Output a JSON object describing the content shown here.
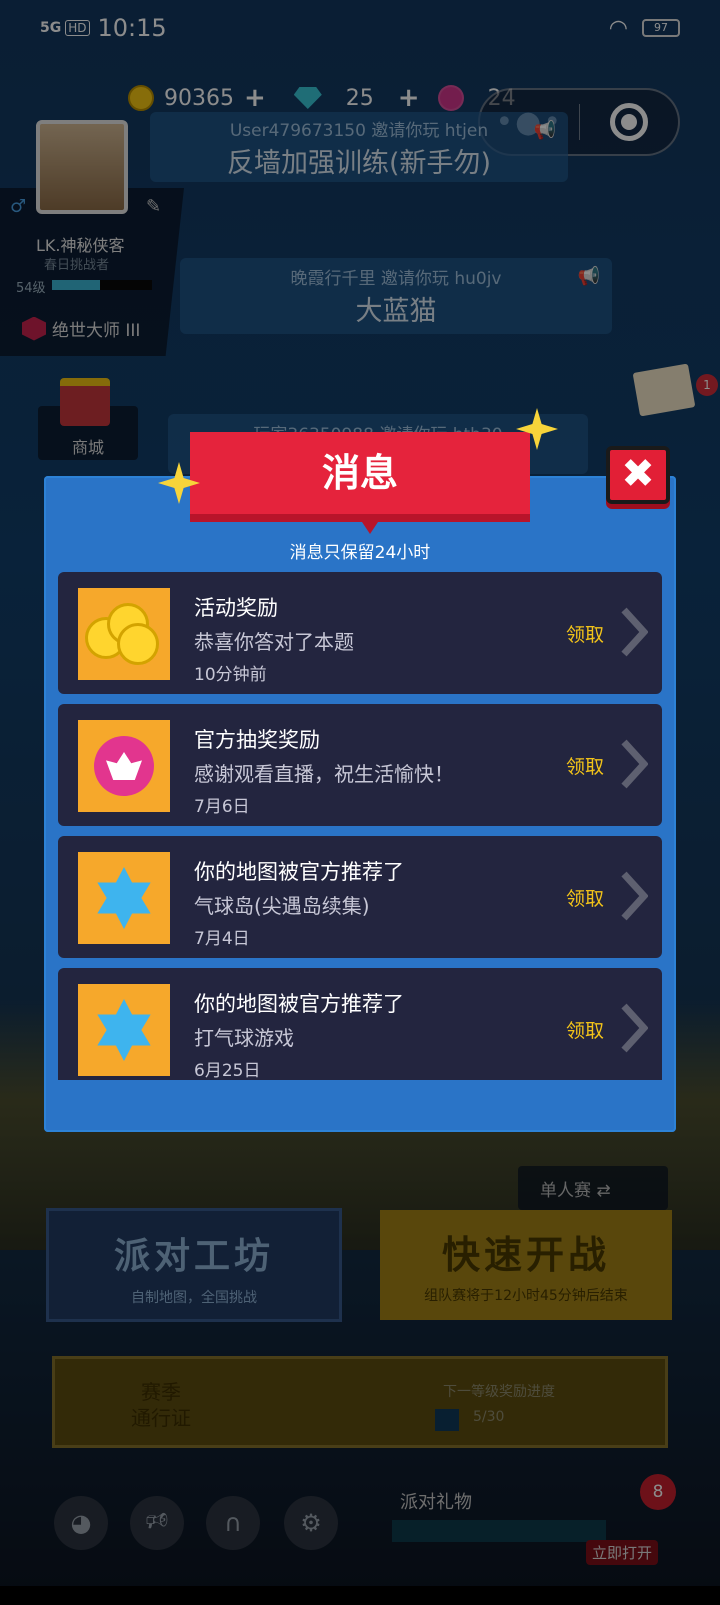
{
  "status_bar": {
    "signal": "5G",
    "hd": "HD",
    "time": "10:15",
    "battery": "97"
  },
  "currency": {
    "coins": "90365",
    "gems": "25",
    "tickets": "24"
  },
  "profile": {
    "name": "LK.神秘侠客",
    "subtitle": "春日挑战者",
    "level": "54级",
    "rank": "绝世大师 III",
    "level_progress": 0.48
  },
  "chat": [
    {
      "who": "User479673150 邀请你玩 htjen",
      "what": "反墙加强训练(新手勿)"
    },
    {
      "who": "晚霞行千里 邀请你玩 hu0jv",
      "what": "大蓝猫"
    },
    {
      "who": "玩家36350988 邀请你玩 htb30",
      "what": ""
    }
  ],
  "shop_label": "商城",
  "cards_badge": "1",
  "dialog": {
    "title": "消息",
    "note": "消息只保留24小时",
    "messages": [
      {
        "icon": "gold-coins-icon",
        "title": "活动奖励",
        "body": "恭喜你答对了本题",
        "time": "10分钟前",
        "action": "领取"
      },
      {
        "icon": "lotus-ticket-icon",
        "title": "官方抽奖奖励",
        "body": "感谢观看直播，祝生活愉快！",
        "time": "7月6日",
        "action": "领取"
      },
      {
        "icon": "blue-crystal-icon",
        "title": "你的地图被官方推荐了",
        "body": "气球岛(尖遇岛续集)",
        "time": "7月4日",
        "action": "领取"
      },
      {
        "icon": "blue-crystal-icon",
        "title": "你的地图被官方推荐了",
        "body": "打气球游戏",
        "time": "6月25日",
        "action": "领取"
      }
    ]
  },
  "bottom": {
    "solo_mode": "单人赛",
    "workshop_title": "派对工坊",
    "workshop_sub": "自制地图，全国挑战",
    "quick_title": "快速开战",
    "quick_sub": "组队赛将于12小时45分钟后结束",
    "pass_label_1": "赛季",
    "pass_label_2": "通行证",
    "pass_progress_label": "下一等级奖励进度",
    "pass_progress": "5/30",
    "gift_label": "派对礼物",
    "gift_open": "立即打开",
    "gift_badge": "8"
  },
  "colors": {
    "dialog_blue": "#2a74c7",
    "banner_red": "#e5233c",
    "card_bg": "#23253f",
    "claim_yellow": "#f2c319",
    "thumb_orange": "#f6a82b"
  }
}
